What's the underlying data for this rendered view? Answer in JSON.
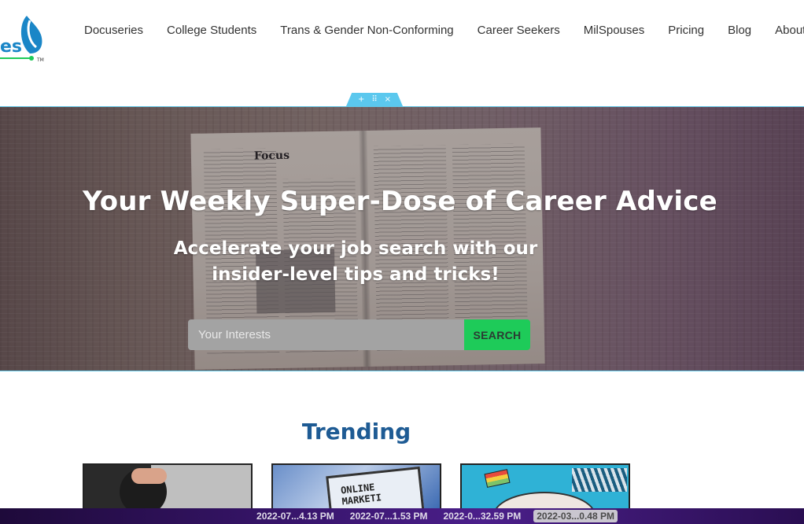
{
  "header": {
    "logo_text": "es",
    "nav": [
      {
        "label": "Docuseries"
      },
      {
        "label": "College Students"
      },
      {
        "label": "Trans & Gender Non-Conforming"
      },
      {
        "label": "Career Seekers"
      },
      {
        "label": "MilSpouses"
      },
      {
        "label": "Pricing"
      },
      {
        "label": "Blog"
      },
      {
        "label": "About"
      }
    ]
  },
  "editor_handle": {
    "add": "+",
    "move": "⠿",
    "close": "×"
  },
  "hero": {
    "title": "Your Weekly Super-Dose of Career Advice",
    "subtitle": "Accelerate your job search with our insider-level tips and tricks!",
    "newspaper_masthead": "Focus",
    "search": {
      "placeholder": "Your Interests",
      "button_label": "SEARCH"
    }
  },
  "trending": {
    "title": "Trending",
    "card_2_text": "ONLINE MARKETI"
  },
  "taskbar": {
    "items": [
      {
        "label": "2022-07...4.13 PM",
        "active": false
      },
      {
        "label": "2022-07...1.53 PM",
        "active": false
      },
      {
        "label": "2022-0...32.59 PM",
        "active": false
      },
      {
        "label": "2022-03...0.48 PM",
        "active": true
      }
    ]
  },
  "colors": {
    "brand_blue": "#1e5b94",
    "search_green": "#1ecb59",
    "accent_cyan": "#5bc8ee"
  }
}
